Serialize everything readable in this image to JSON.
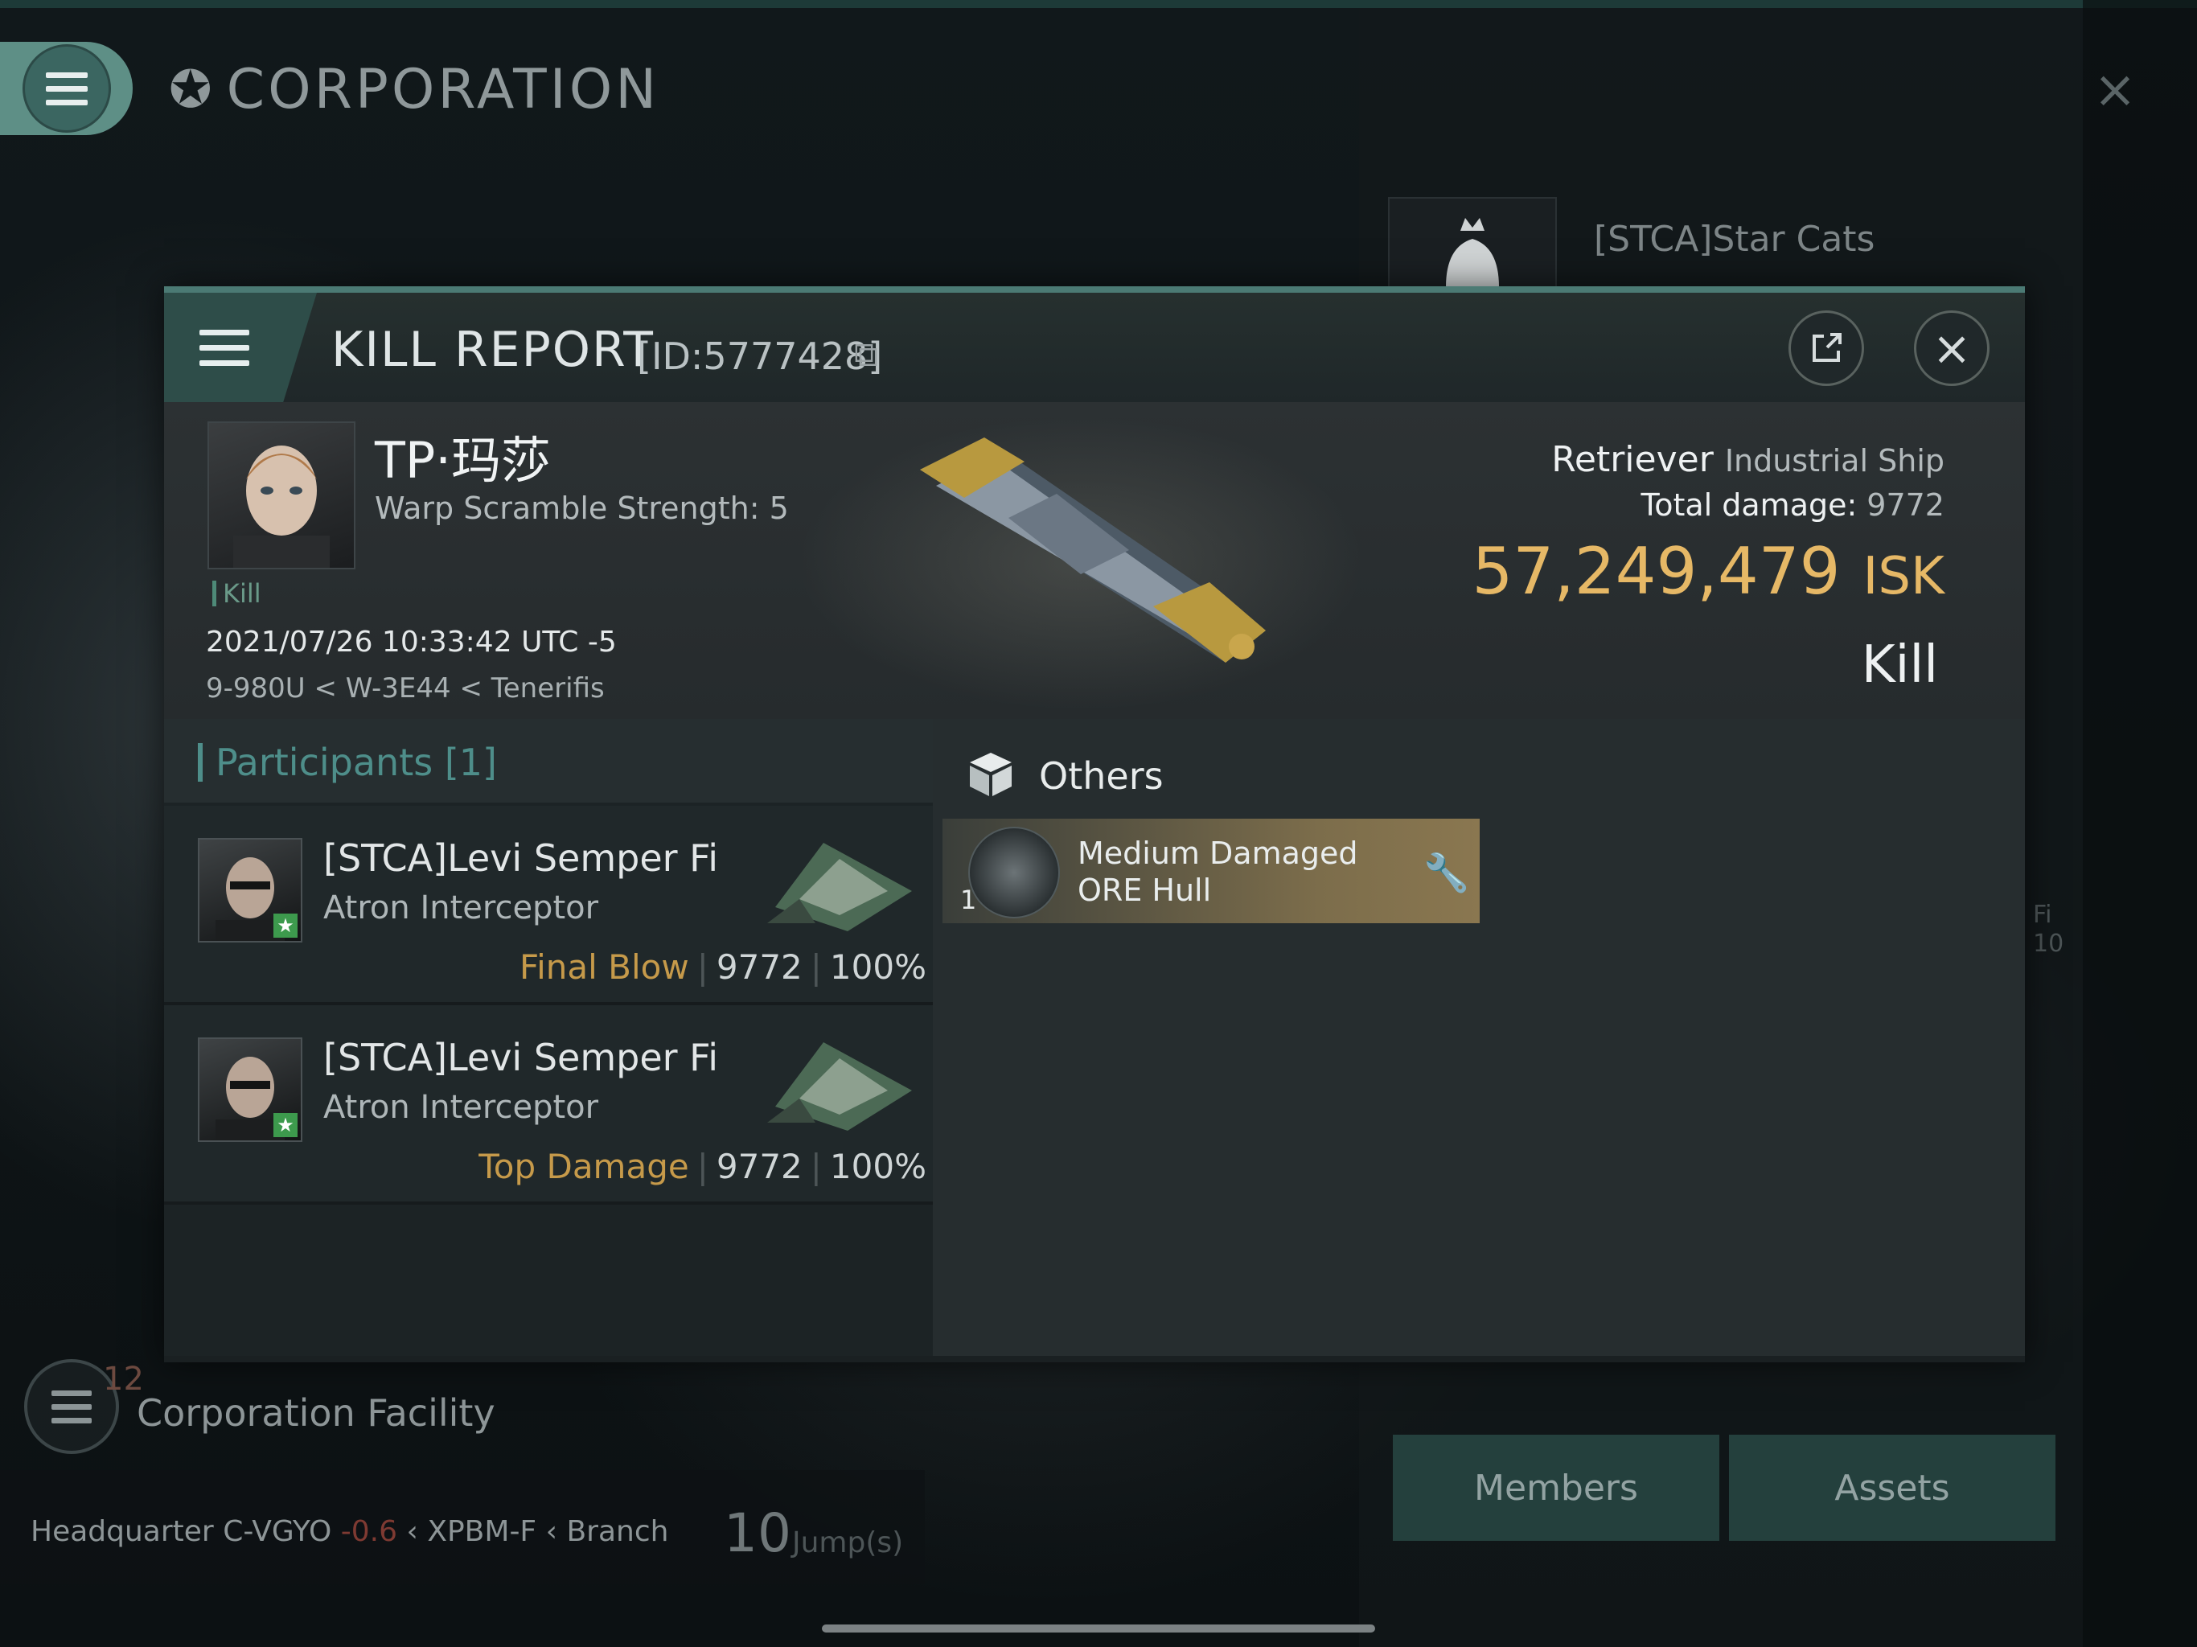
{
  "background": {
    "section_title": "CORPORATION",
    "corp_name": "[STCA]Star Cats",
    "facility_number": "12",
    "facility_label": "Corporation Facility",
    "hq": {
      "label": "Headquarter",
      "system": "C-VGYO",
      "security": "-0.6",
      "region": "XPBM-F",
      "branch": "Branch",
      "jumps": "10",
      "jumps_label": "Jump(s)"
    },
    "tabs": [
      "Members",
      "Assets"
    ],
    "side_fragment": [
      "Fi",
      "10"
    ]
  },
  "kill_report": {
    "title": "KILL REPORT",
    "id": "[ID:5777428]",
    "victim": {
      "name": "TP·玛莎",
      "warp_scramble": "Warp Scramble Strength: 5",
      "tag": "Kill",
      "time": "2021/07/26 10:33:42 UTC -5",
      "location": "9-980U < W-3E44 < Tenerifis"
    },
    "ship": {
      "name": "Retriever",
      "class": "Industrial Ship",
      "total_damage_label": "Total damage:",
      "total_damage": "9772",
      "isk_value": "57,249,479",
      "isk_unit": "ISK",
      "result": "Kill"
    },
    "participants": {
      "title": "Participants [1]",
      "rows": [
        {
          "name": "[STCA]Levi Semper Fi",
          "ship": "Atron Interceptor",
          "label": "Final Blow",
          "damage": "9772",
          "percent": "100%"
        },
        {
          "name": "[STCA]Levi Semper Fi",
          "ship": "Atron Interceptor",
          "label": "Top Damage",
          "damage": "9772",
          "percent": "100%"
        }
      ]
    },
    "others": {
      "title": "Others",
      "items": [
        {
          "qty": "1",
          "name_line1": "Medium Damaged",
          "name_line2": "ORE Hull"
        }
      ]
    }
  },
  "colors": {
    "accent": "#4b7a74",
    "isk": "#e6b866",
    "label_gold": "#c69a4a",
    "teal_text": "#4e8e8a"
  },
  "icons": [
    "hamburger-icon",
    "corporation-star-icon",
    "close-icon",
    "share-icon",
    "copy-icon",
    "cube-icon",
    "wrench-icon",
    "standing-star-icon"
  ]
}
